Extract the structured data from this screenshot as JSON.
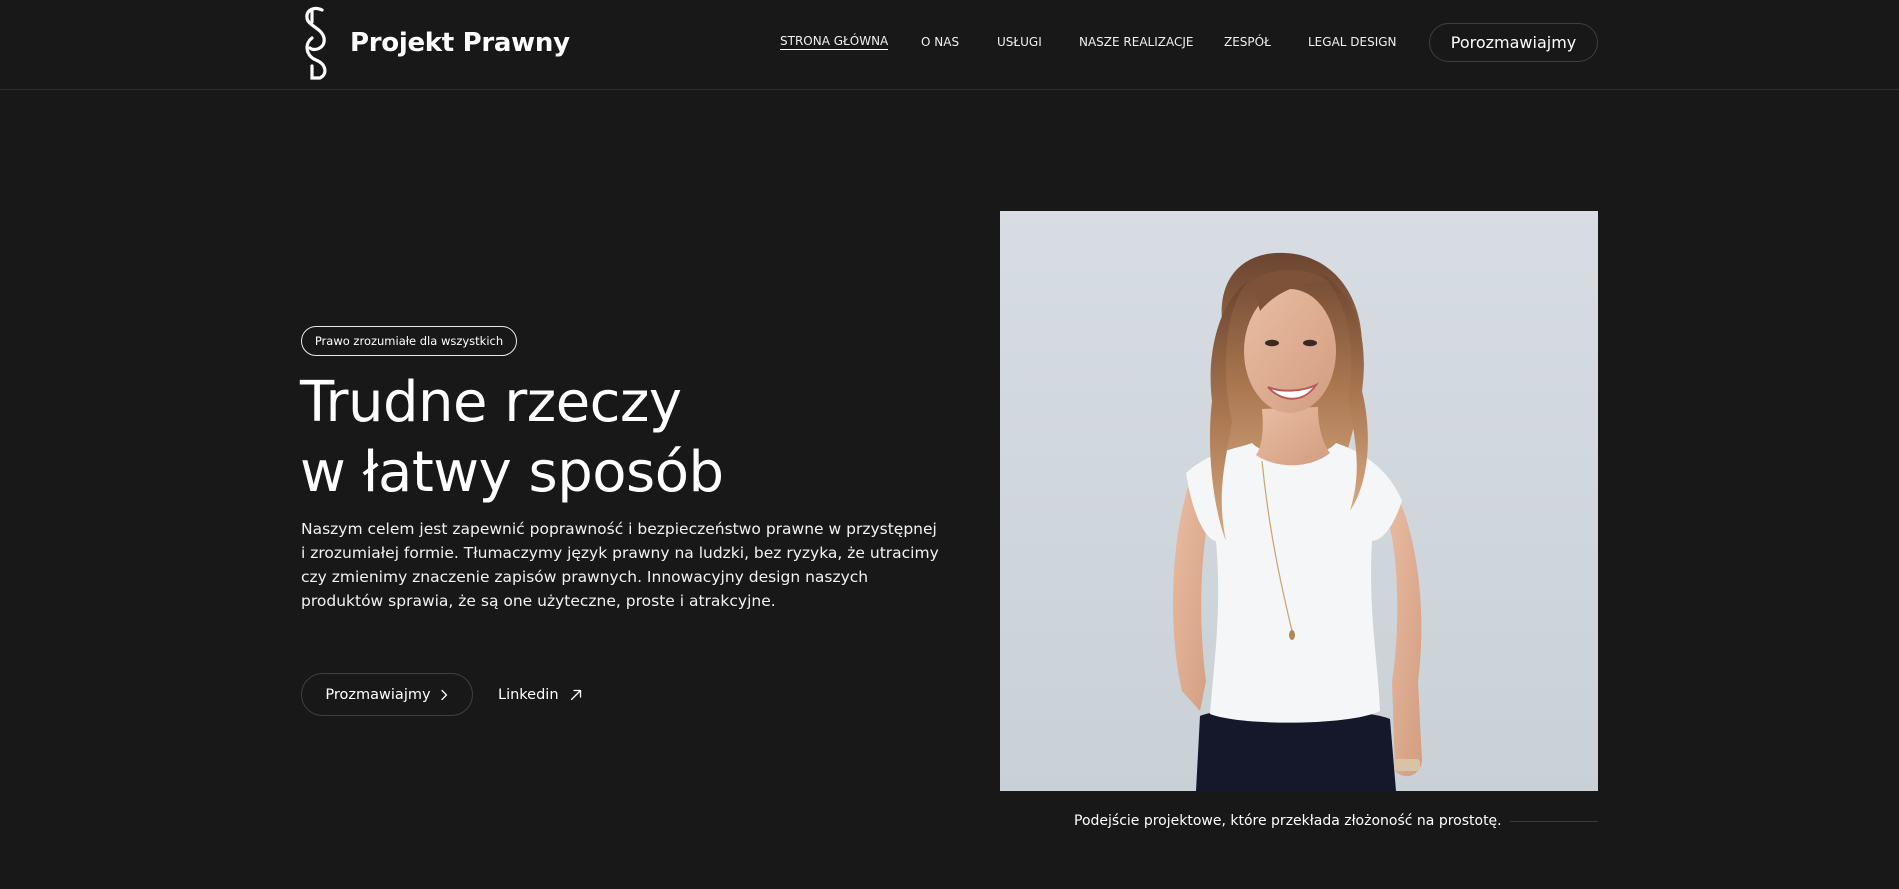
{
  "header": {
    "brand": "Projekt Prawny",
    "nav": [
      {
        "label": "STRONA GŁÓWNA",
        "active": true
      },
      {
        "label": "O NAS",
        "active": false
      },
      {
        "label": "USŁUGI",
        "active": false
      },
      {
        "label": "NASZE REALIZACJE",
        "active": false
      },
      {
        "label": "ZESPÓŁ",
        "active": false
      },
      {
        "label": "LEGAL DESIGN",
        "active": false
      }
    ],
    "cta": "Porozmawiajmy"
  },
  "hero": {
    "badge": "Prawo zrozumiałe dla wszystkich",
    "title_line1": "Trudne rzeczy",
    "title_line2": "w łatwy sposób",
    "description": "Naszym celem jest zapewnić poprawność i bezpieczeństwo prawne w przystępnej i zrozumiałej formie. Tłumaczymy język prawny na ludzki, bez ryzyka, że utracimy czy zmienimy znaczenie zapisów prawnych. Innowacyjny design naszych produktów sprawia, że są one użyteczne, proste i atrakcyjne.",
    "primary_button": "Prozmawiajmy",
    "secondary_link": "Linkedin",
    "primary_icon": "chevron-right-icon",
    "secondary_icon": "arrow-up-right-icon"
  },
  "photo": {
    "caption": "Podejście projektowe, które przekłada złożoność na prostotę."
  },
  "colors": {
    "background": "#181818",
    "text": "#ffffff",
    "border": "#404040",
    "photo_bg": "#d3dadf"
  }
}
